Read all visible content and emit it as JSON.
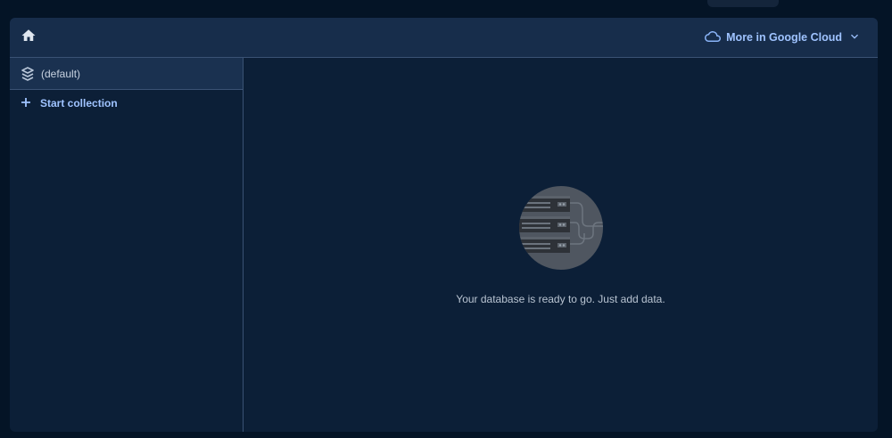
{
  "header": {
    "home_icon": "home-icon",
    "google_cloud_label": "More in Google Cloud",
    "cloud_icon": "cloud-icon",
    "chevron_icon": "chevron-down-icon"
  },
  "sidebar": {
    "database_name": "(default)",
    "database_icon": "database-icon",
    "start_collection_label": "Start collection",
    "add_icon": "plus-icon"
  },
  "main": {
    "empty_message": "Your database is ready to go. Just add data.",
    "illustration_icon": "server-rack-icon"
  },
  "colors": {
    "background": "#041426",
    "panel": "#0c1f37",
    "header": "#172d4b",
    "accent": "#8ab4f8"
  }
}
